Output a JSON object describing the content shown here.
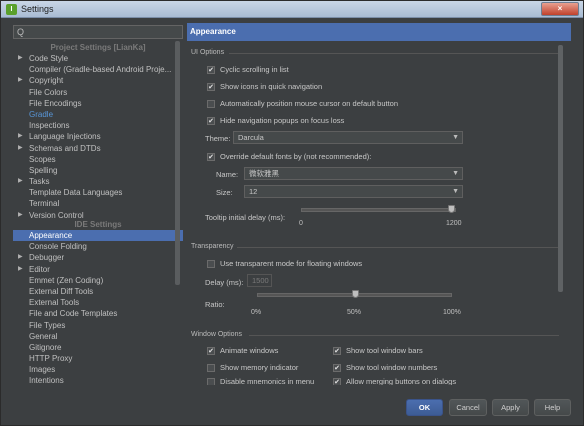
{
  "window": {
    "title": "Settings",
    "app_icon": "intellij-icon",
    "close_label": "×"
  },
  "search": {
    "placeholder": "",
    "icon": "search-icon",
    "glyph": "Q"
  },
  "project_settings_header": "Project Settings [LianKa]",
  "project_settings": [
    {
      "label": "Code Style",
      "expandable": true
    },
    {
      "label": "Compiler (Gradle-based Android Proje...",
      "expandable": false
    },
    {
      "label": "Copyright",
      "expandable": true
    },
    {
      "label": "File Colors",
      "expandable": false
    },
    {
      "label": "File Encodings",
      "expandable": false
    },
    {
      "label": "Gradle",
      "expandable": false,
      "active": true
    },
    {
      "label": "Inspections",
      "expandable": false
    },
    {
      "label": "Language Injections",
      "expandable": true
    },
    {
      "label": "Schemas and DTDs",
      "expandable": true
    },
    {
      "label": "Scopes",
      "expandable": false
    },
    {
      "label": "Spelling",
      "expandable": false
    },
    {
      "label": "Tasks",
      "expandable": true
    },
    {
      "label": "Template Data Languages",
      "expandable": false
    },
    {
      "label": "Terminal",
      "expandable": false
    },
    {
      "label": "Version Control",
      "expandable": true
    }
  ],
  "ide_settings_header": "IDE Settings",
  "ide_settings": [
    {
      "label": "Appearance",
      "expandable": false,
      "selected": true
    },
    {
      "label": "Console Folding",
      "expandable": false
    },
    {
      "label": "Debugger",
      "expandable": true
    },
    {
      "label": "Editor",
      "expandable": true
    },
    {
      "label": "Emmet (Zen Coding)",
      "expandable": false
    },
    {
      "label": "External Diff Tools",
      "expandable": false
    },
    {
      "label": "External Tools",
      "expandable": false
    },
    {
      "label": "File and Code Templates",
      "expandable": false
    },
    {
      "label": "File Types",
      "expandable": false
    },
    {
      "label": "General",
      "expandable": false
    },
    {
      "label": "Gitignore",
      "expandable": false
    },
    {
      "label": "HTTP Proxy",
      "expandable": false
    },
    {
      "label": "Images",
      "expandable": false
    },
    {
      "label": "Intentions",
      "expandable": false
    }
  ],
  "panel": {
    "title": "Appearance",
    "ui_options": {
      "label": "UI Options",
      "cyclic_scrolling": {
        "label": "Cyclic scrolling in list",
        "checked": true
      },
      "show_icons": {
        "label": "Show icons in quick navigation",
        "checked": true
      },
      "auto_position": {
        "label": "Automatically position mouse cursor on default button",
        "checked": false
      },
      "hide_popups": {
        "label": "Hide navigation popups on focus loss",
        "checked": true
      },
      "theme_label": "Theme:",
      "theme_value": "Darcula",
      "override_fonts": {
        "label": "Override default fonts by (not recommended):",
        "checked": true
      },
      "name_label": "Name:",
      "name_value": "微软雅黑",
      "size_label": "Size:",
      "size_value": "12",
      "tooltip_label": "Tooltip initial delay (ms):",
      "tooltip_min": "0",
      "tooltip_max": "1200",
      "tooltip_value_fraction": 1.0
    },
    "transparency": {
      "label": "Transparency",
      "use_transparent": {
        "label": "Use transparent mode for floating windows",
        "checked": false
      },
      "delay_label": "Delay (ms):",
      "delay_value": "1500",
      "ratio_label": "Ratio:",
      "ratio_min": "0%",
      "ratio_mid": "50%",
      "ratio_max": "100%",
      "ratio_value_fraction": 0.5
    },
    "window_options": {
      "label": "Window Options",
      "animate_windows": {
        "label": "Animate windows",
        "checked": true
      },
      "show_tool_window_bars": {
        "label": "Show tool window bars",
        "checked": true
      },
      "show_memory": {
        "label": "Show memory indicator",
        "checked": false
      },
      "show_tool_window_numbers": {
        "label": "Show tool window numbers",
        "checked": true
      },
      "disable_mnemonics": {
        "label": "Disable mnemonics in menu",
        "checked": false
      },
      "allow_merging": {
        "label": "Allow merging buttons on dialogs",
        "checked": true
      }
    }
  },
  "buttons": {
    "ok": "OK",
    "cancel": "Cancel",
    "apply": "Apply",
    "help": "Help"
  },
  "colors": {
    "background": "#3c3f41",
    "selection": "#4b6eaf",
    "accent_text": "#5896d8"
  }
}
